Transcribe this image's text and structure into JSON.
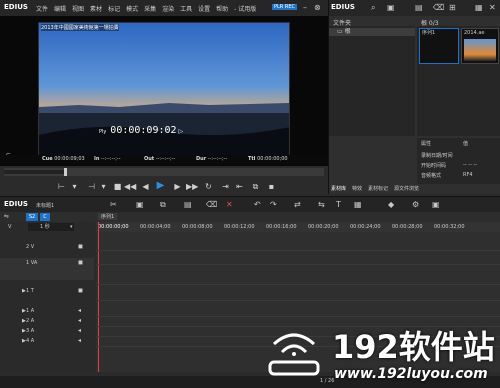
{
  "app": {
    "logo": "EDIUS",
    "menu": [
      "文件",
      "编辑",
      "视图",
      "素材",
      "标记",
      "模式",
      "采集",
      "渲染",
      "工具",
      "设置",
      "帮助",
      "- 试用版"
    ],
    "plr_rec": "PLR REC"
  },
  "preview": {
    "title": "2013年中國國家美術館第一場拍賣",
    "ply_label": "Ply",
    "timecode": "00:00:09:02",
    "play_indicator": "▷",
    "cue": {
      "label": "Cue",
      "value": "00:00:09;03"
    },
    "in": {
      "label": "In",
      "value": "--:--:--;--"
    },
    "out": {
      "label": "Out",
      "value": "--:--:--;--"
    },
    "dur": {
      "label": "Dur",
      "value": "--:--:--;--"
    },
    "ttl": {
      "label": "Ttl",
      "value": "00:00:00;00"
    }
  },
  "bin": {
    "logo": "EDIUS",
    "folder_header": "文件夹",
    "root_folder": "根",
    "path": "根 0/3",
    "clip_label": "序列1",
    "clip2_label": "2014.ae",
    "props": {
      "col1": "属性",
      "col2": "值",
      "rows": [
        {
          "key": "录制日期/时间",
          "value": ""
        },
        {
          "key": "开始时间码",
          "value": "-- -- --"
        },
        {
          "key": "音频格式",
          "value": "RF4"
        }
      ]
    },
    "tabs": [
      "素材库",
      "特效",
      "素材标记",
      "源文件浏览"
    ]
  },
  "timeline": {
    "logo": "EDIUS",
    "project": "未标题1",
    "sequence_tab": "序列1",
    "ruler": [
      "00:00:00;00",
      "00:00:04;00",
      "00:00:08;00",
      "00:00:12;00",
      "00:00:16;00",
      "00:00:20;00",
      "00:00:24;00",
      "00:00:28;00",
      "00:00:32;00"
    ],
    "zoom": "1 秒",
    "tracks": [
      "2 V",
      "1 VA",
      "1 T",
      "1 A",
      "2 A",
      "3 A",
      "4 A"
    ],
    "status": "1 / 26"
  },
  "watermark": {
    "brand": "192软件站",
    "url": "www.192luyou.com"
  },
  "colors": {
    "accent": "#1e73c8",
    "sky": "#4a89d6",
    "sunset": "#f08a24"
  }
}
